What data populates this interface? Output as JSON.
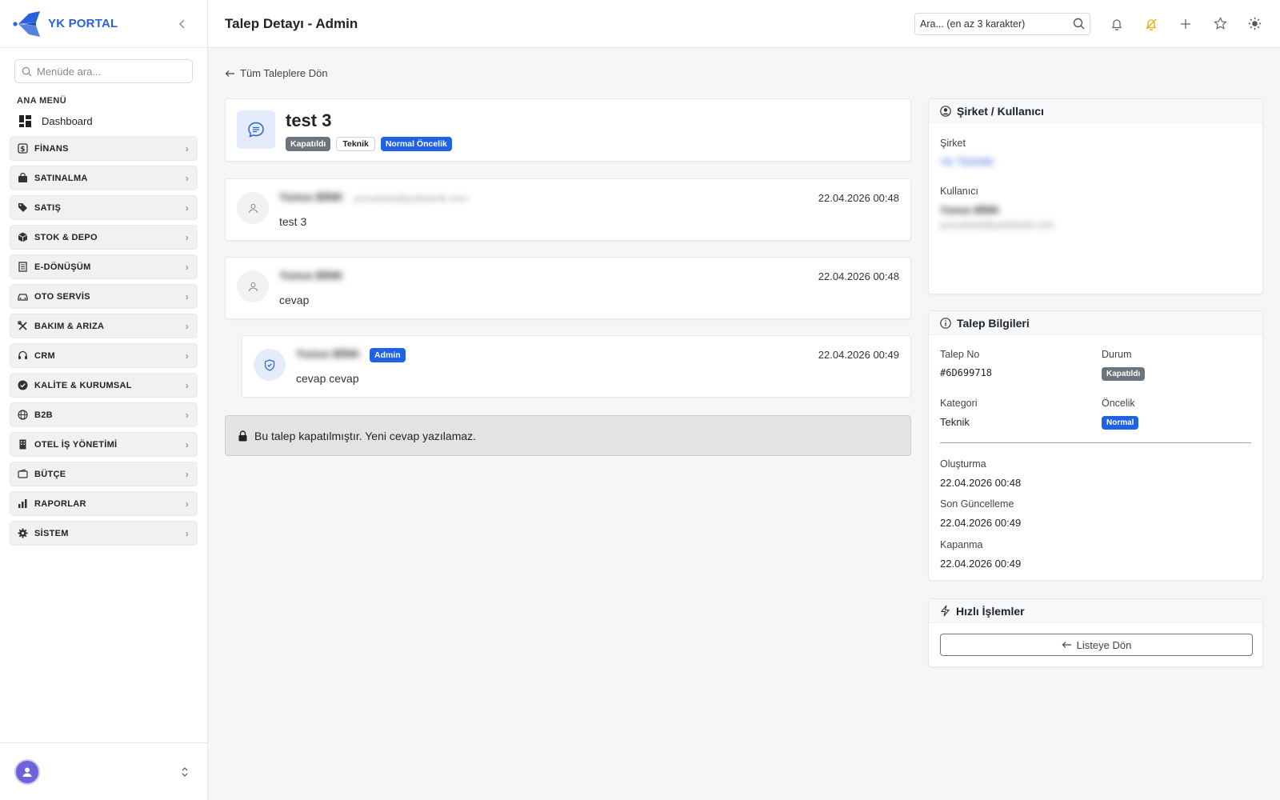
{
  "sidebar": {
    "brand": "YK PORTAL",
    "search_placeholder": "Menüde ara...",
    "section_label": "ANA MENÜ",
    "dashboard_label": "Dashboard",
    "items": [
      {
        "label": "FİNANS",
        "icon": "finance-icon"
      },
      {
        "label": "SATINALMA",
        "icon": "bag-icon"
      },
      {
        "label": "SATIŞ",
        "icon": "tag-icon"
      },
      {
        "label": "STOK & DEPO",
        "icon": "box-icon"
      },
      {
        "label": "E-DÖNÜŞÜM",
        "icon": "receipt-icon"
      },
      {
        "label": "OTO SERVİS",
        "icon": "car-icon"
      },
      {
        "label": "BAKIM & ARIZA",
        "icon": "tools-icon"
      },
      {
        "label": "CRM",
        "icon": "headset-icon"
      },
      {
        "label": "KALİTE & KURUMSAL",
        "icon": "check-badge-icon"
      },
      {
        "label": "B2B",
        "icon": "globe-icon"
      },
      {
        "label": "OTEL İŞ YÖNETİMİ",
        "icon": "building-icon"
      },
      {
        "label": "BÜTÇE",
        "icon": "wallet-icon"
      },
      {
        "label": "RAPORLAR",
        "icon": "bar-chart-icon"
      },
      {
        "label": "SİSTEM",
        "icon": "gear-icon"
      }
    ]
  },
  "topbar": {
    "title": "Talep Detayı - Admin",
    "search_placeholder": "Ara... (en az 3 karakter)"
  },
  "main": {
    "back_label": "Tüm Taleplere Dön",
    "ticket": {
      "title": "test 3",
      "status_badge": "Kapatıldı",
      "category_badge": "Teknik",
      "priority_badge": "Normal Öncelik"
    },
    "messages": [
      {
        "author": "Yunus BİNK",
        "email": "yunusbink@yukteknik.com",
        "date": "22.04.2026 00:48",
        "text": "test 3"
      },
      {
        "author": "Yunus BİNK",
        "date": "22.04.2026 00:48",
        "text": "cevap"
      },
      {
        "author": "Yunus BİNK",
        "role_badge": "Admin",
        "date": "22.04.2026 00:49",
        "text": "cevap cevap"
      }
    ],
    "closed_notice": "Bu talep kapatılmıştır. Yeni cevap yazılamaz."
  },
  "company_panel": {
    "title": "Şirket / Kullanıcı",
    "company_label": "Şirket",
    "company_value": "YK TEKNİK",
    "user_label": "Kullanıcı",
    "user_name": "Yunus BİNK",
    "user_email": "yunusbink@yukteknik.com"
  },
  "info_panel": {
    "title": "Talep Bilgileri",
    "no_label": "Talep No",
    "no_value": "#6D699718",
    "status_label": "Durum",
    "status_value": "Kapatıldı",
    "category_label": "Kategori",
    "category_value": "Teknik",
    "priority_label": "Öncelik",
    "priority_value": "Normal",
    "created_label": "Oluşturma",
    "created_value": "22.04.2026 00:48",
    "updated_label": "Son Güncelleme",
    "updated_value": "22.04.2026 00:49",
    "closed_label": "Kapanma",
    "closed_value": "22.04.2026 00:49"
  },
  "actions_panel": {
    "title": "Hızlı İşlemler",
    "back_button": "Listeye Dön"
  },
  "colors": {
    "brand": "#2a62d9",
    "primary_badge": "#1f62e6",
    "closed_badge": "#6c757d",
    "alert_bg": "#e2e3e5",
    "avatar": "#6c63d9",
    "bell_off": "#e0b000"
  }
}
